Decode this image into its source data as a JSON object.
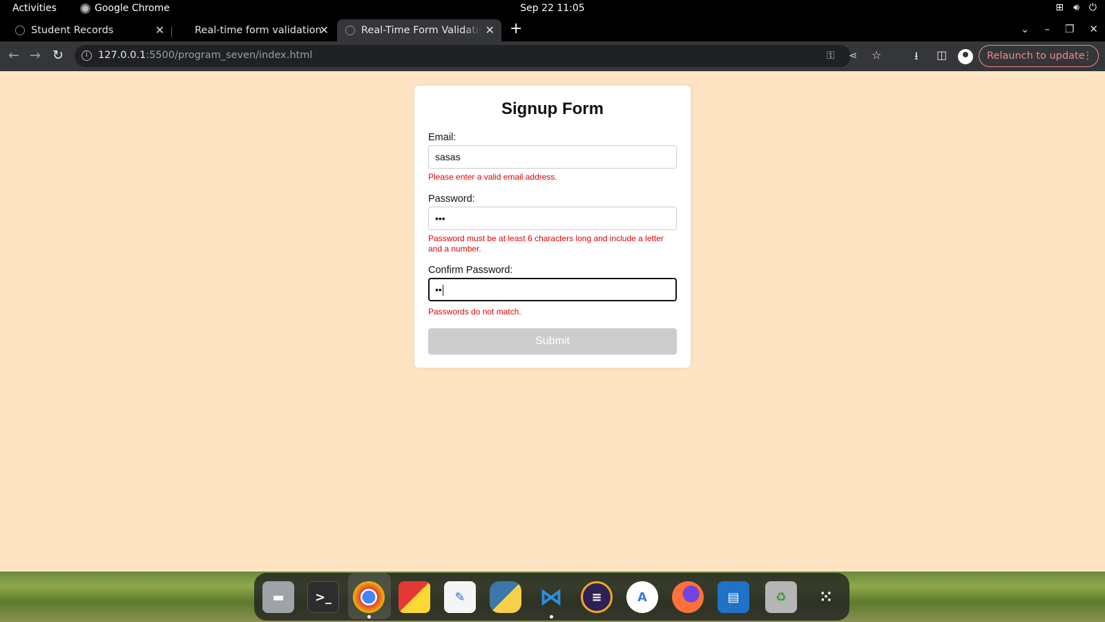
{
  "topbar": {
    "activities": "Activities",
    "app_name": "Google Chrome",
    "clock": "Sep 22  11:05"
  },
  "browser": {
    "tabs": [
      {
        "title": "Student Records"
      },
      {
        "title": "Real-time form validation"
      },
      {
        "title": "Real-Time Form Validation",
        "active": true
      }
    ],
    "url_host": "127.0.0.1",
    "url_rest": ":5500/program_seven/index.html",
    "relaunch_label": "Relaunch to update"
  },
  "form": {
    "heading": "Signup Form",
    "email_label": "Email:",
    "email_value": "sasas",
    "email_error": "Please enter a valid email address.",
    "password_label": "Password:",
    "password_value": "•••",
    "password_error": "Password must be at least 6 characters long and include a letter and a number.",
    "confirm_label": "Confirm Password:",
    "confirm_value": "••",
    "confirm_error": "Passwords do not match.",
    "submit_label": "Submit"
  },
  "dock": {
    "apps": [
      "files-icon",
      "terminal-icon",
      "chrome-icon",
      "app-grid-color-icon",
      "text-editor-icon",
      "python-icon",
      "vscode-icon",
      "eclipse-icon",
      "android-studio-icon",
      "firefox-icon",
      "writer-icon",
      "trash-icon",
      "show-apps-icon"
    ]
  },
  "colors": {
    "page_bg": "#ffe4c4",
    "error": "#e00000",
    "submit_disabled": "#cccccc",
    "relaunch": "#f28b82"
  }
}
